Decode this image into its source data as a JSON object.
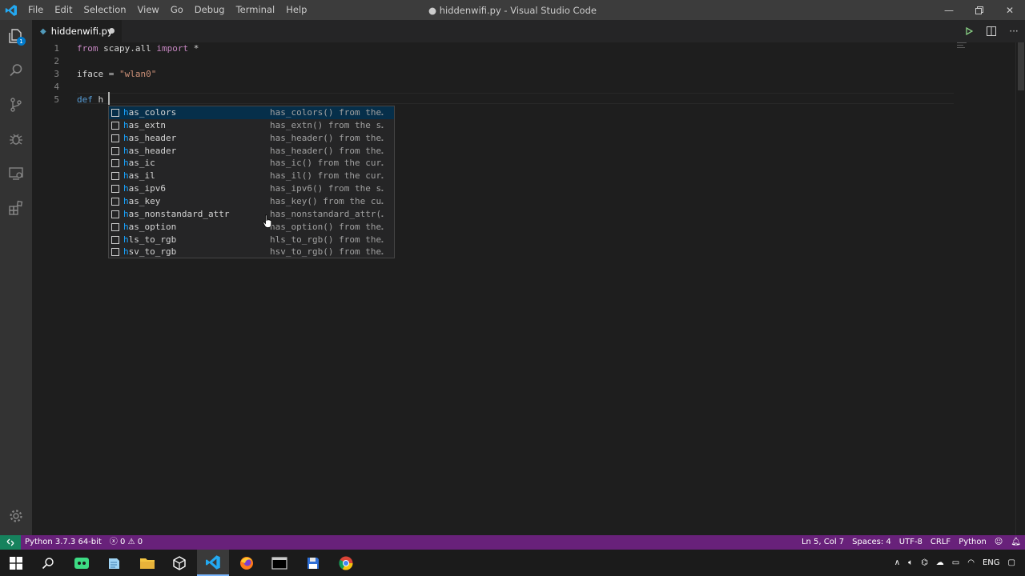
{
  "window": {
    "title": "● hiddenwifi.py - Visual Studio Code",
    "menu": [
      "File",
      "Edit",
      "Selection",
      "View",
      "Go",
      "Debug",
      "Terminal",
      "Help"
    ]
  },
  "activity_bar": {
    "explorer_badge": "1",
    "items": [
      "files-icon",
      "search-icon",
      "source-control-icon",
      "debug-icon",
      "remote-explorer-icon",
      "extensions-icon",
      "gear-icon"
    ]
  },
  "tab": {
    "name": "hiddenwifi.py",
    "dirty": true
  },
  "editor": {
    "line_numbers": [
      "1",
      "2",
      "3",
      "4",
      "5"
    ],
    "lines": [
      [
        {
          "t": "from",
          "c": "kw"
        },
        {
          "t": " scapy.all ",
          "c": ""
        },
        {
          "t": "import",
          "c": "kw"
        },
        {
          "t": " *",
          "c": ""
        }
      ],
      [],
      [
        {
          "t": "iface = ",
          "c": ""
        },
        {
          "t": "\"wlan0\"",
          "c": "str"
        }
      ],
      [],
      [
        {
          "t": "def",
          "c": "kwd"
        },
        {
          "t": " h",
          "c": ""
        }
      ]
    ]
  },
  "suggestions": [
    {
      "match": "h",
      "rest": "as_colors",
      "detail": "has_colors() from the…",
      "selected": true
    },
    {
      "match": "h",
      "rest": "as_extn",
      "detail": "has_extn() from the s…"
    },
    {
      "match": "h",
      "rest": "as_header",
      "detail": "has_header() from the…"
    },
    {
      "match": "h",
      "rest": "as_header",
      "detail": "has_header() from the…"
    },
    {
      "match": "h",
      "rest": "as_ic",
      "detail": "has_ic() from the cur…"
    },
    {
      "match": "h",
      "rest": "as_il",
      "detail": "has_il() from the cur…"
    },
    {
      "match": "h",
      "rest": "as_ipv6",
      "detail": "has_ipv6() from the s…"
    },
    {
      "match": "h",
      "rest": "as_key",
      "detail": "has_key() from the cu…"
    },
    {
      "match": "h",
      "rest": "as_nonstandard_attr",
      "detail": "has_nonstandard_attr(…"
    },
    {
      "match": "h",
      "rest": "as_option",
      "detail": "has_option() from the…"
    },
    {
      "match": "h",
      "rest": "ls_to_rgb",
      "detail": "hls_to_rgb() from the…"
    },
    {
      "match": "h",
      "rest": "sv_to_rgb",
      "detail": "hsv_to_rgb() from the…"
    }
  ],
  "status_bar": {
    "interpreter": "Python 3.7.3 64-bit",
    "errors": "0",
    "warnings": "0",
    "position": "Ln 5, Col 7",
    "spaces": "Spaces: 4",
    "encoding": "UTF-8",
    "eol": "CRLF",
    "language": "Python"
  },
  "taskbar": {
    "apps": [
      "windows-start-icon",
      "search-icon",
      "android-studio-icon",
      "notepad-icon",
      "file-explorer-icon",
      "virtualbox-icon",
      "vscode-icon",
      "firefox-icon",
      "terminal-icon",
      "floppy-save-icon",
      "chrome-icon"
    ],
    "language": "ENG"
  },
  "colors": {
    "statusbar": "#68217a",
    "accent": "#007acc",
    "selection": "#062f4a"
  }
}
